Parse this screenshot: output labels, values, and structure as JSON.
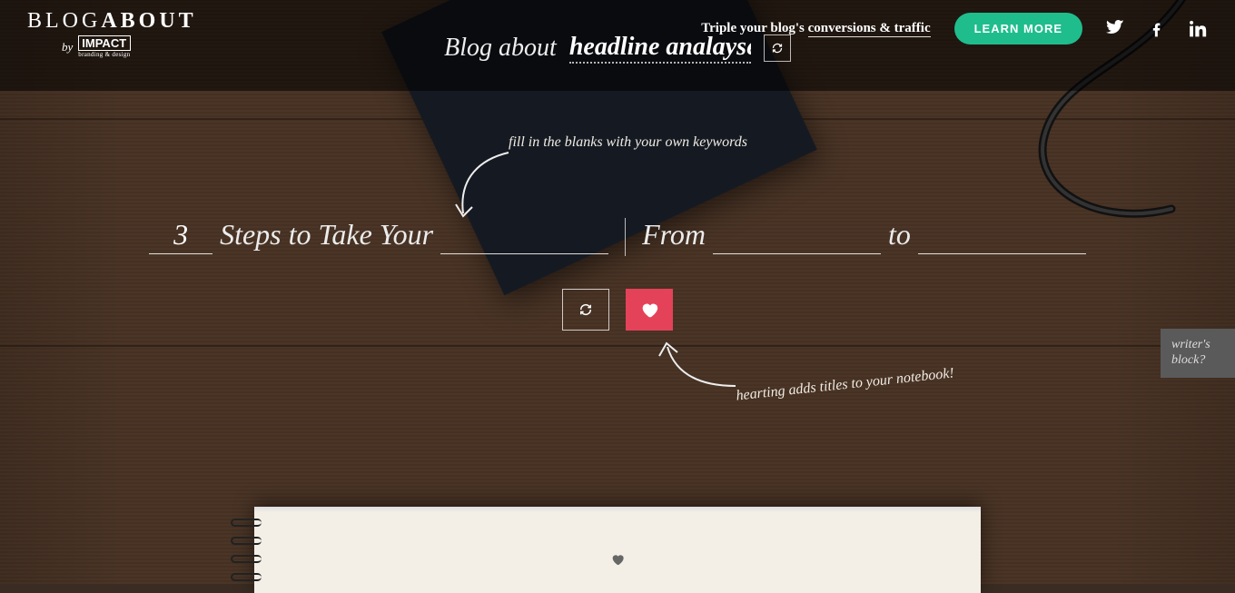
{
  "header": {
    "logo_light": "BLOG",
    "logo_bold": "ABOUT",
    "by": "by",
    "impact": "IMPACT",
    "impact_sub": "branding & design",
    "promo_prefix": "Triple your blog's ",
    "promo_underlined": "conversions & traffic",
    "learn_more": "LEARN MORE"
  },
  "topic": {
    "label": "Blog about",
    "value": "headline analayser"
  },
  "hints": {
    "fill": "fill in the blanks with your own keywords",
    "heart": "hearting adds titles to your notebook!"
  },
  "headline": {
    "blank1_value": "3",
    "part1": "Steps to Take Your",
    "part2": "From",
    "part3": "to"
  },
  "side": {
    "writers_block": "writer's block?"
  },
  "colors": {
    "accent_green": "#1fbd8c",
    "accent_red": "#e44258"
  }
}
